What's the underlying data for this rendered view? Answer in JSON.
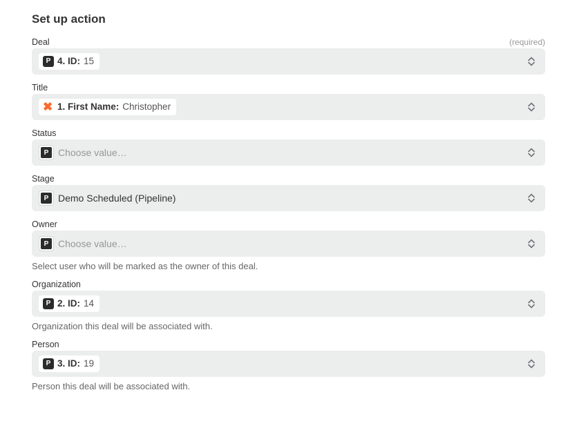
{
  "header": {
    "title": "Set up action"
  },
  "badges": {
    "p_letter": "P"
  },
  "fields": {
    "deal": {
      "label": "Deal",
      "required_text": "(required)",
      "pill_key": "4. ID:",
      "pill_val": "15"
    },
    "title": {
      "label": "Title",
      "pill_key": "1. First Name:",
      "pill_val": "Christopher"
    },
    "status": {
      "label": "Status",
      "placeholder": "Choose value…"
    },
    "stage": {
      "label": "Stage",
      "value": "Demo Scheduled (Pipeline)"
    },
    "owner": {
      "label": "Owner",
      "placeholder": "Choose value…",
      "help": "Select user who will be marked as the owner of this deal."
    },
    "organization": {
      "label": "Organization",
      "pill_key": "2. ID:",
      "pill_val": "14",
      "help": "Organization this deal will be associated with."
    },
    "person": {
      "label": "Person",
      "pill_key": "3. ID:",
      "pill_val": "19",
      "help": "Person this deal will be associated with."
    }
  }
}
